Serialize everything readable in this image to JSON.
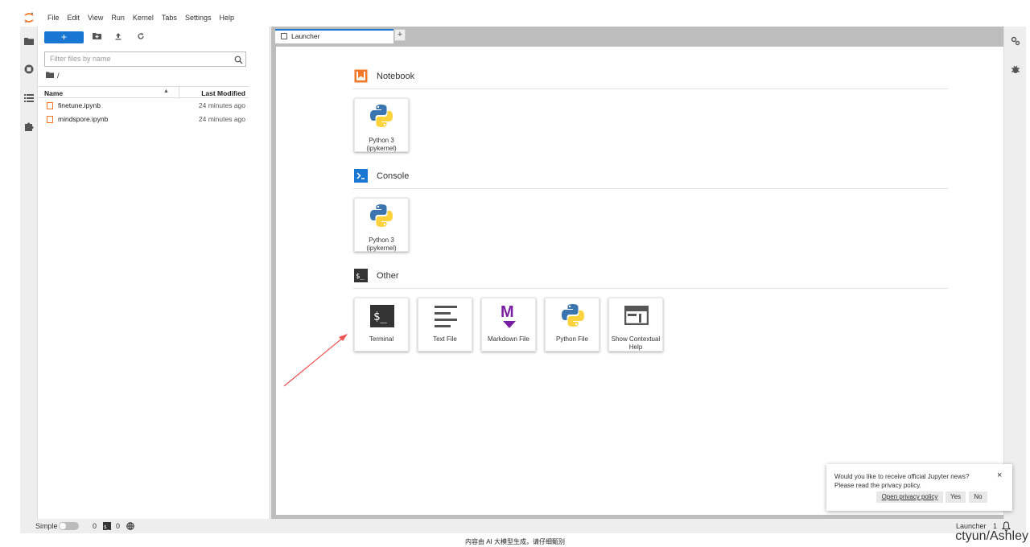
{
  "menubar": {
    "items": [
      "File",
      "Edit",
      "View",
      "Run",
      "Kernel",
      "Tabs",
      "Settings",
      "Help"
    ]
  },
  "filebrowser": {
    "new_label": "+",
    "filter_placeholder": "Filter files by name",
    "breadcrumb": "/",
    "col_name": "Name",
    "col_modified": "Last Modified",
    "files": [
      {
        "name": "finetune.ipynb",
        "modified": "24 minutes ago"
      },
      {
        "name": "mindspore.ipynb",
        "modified": "24 minutes ago"
      }
    ]
  },
  "tabs": {
    "active_label": "Launcher",
    "add_label": "+"
  },
  "launcher": {
    "notebook_title": "Notebook",
    "console_title": "Console",
    "other_title": "Other",
    "notebook_cards": [
      {
        "label": "Python 3 (ipykernel)"
      }
    ],
    "console_cards": [
      {
        "label": "Python 3 (ipykernel)"
      }
    ],
    "other_cards": [
      {
        "label": "Terminal",
        "icon": "terminal-icon"
      },
      {
        "label": "Text File",
        "icon": "text-file-icon"
      },
      {
        "label": "Markdown File",
        "icon": "markdown-icon"
      },
      {
        "label": "Python File",
        "icon": "python-icon"
      },
      {
        "label": "Show Contextual Help",
        "icon": "contextual-help-icon"
      }
    ]
  },
  "statusbar": {
    "mode_label": "Simple",
    "kernels_count": "0",
    "terminals_count": "0",
    "right_label": "Launcher",
    "notif_count": "1"
  },
  "notification": {
    "line1": "Would you like to receive official Jupyter news?",
    "line2": "Please read the privacy policy.",
    "open_label": "Open privacy policy",
    "yes_label": "Yes",
    "no_label": "No",
    "close_label": "×"
  },
  "footer": "内容由 AI 大模型生成，请仔细甄别",
  "watermark": "ctyun/Ashley",
  "colors": {
    "accent": "#1976d2",
    "notebook_orange": "#f37726",
    "markdown_purple": "#7b1fa2",
    "annotation_arrow": "#f05454"
  }
}
